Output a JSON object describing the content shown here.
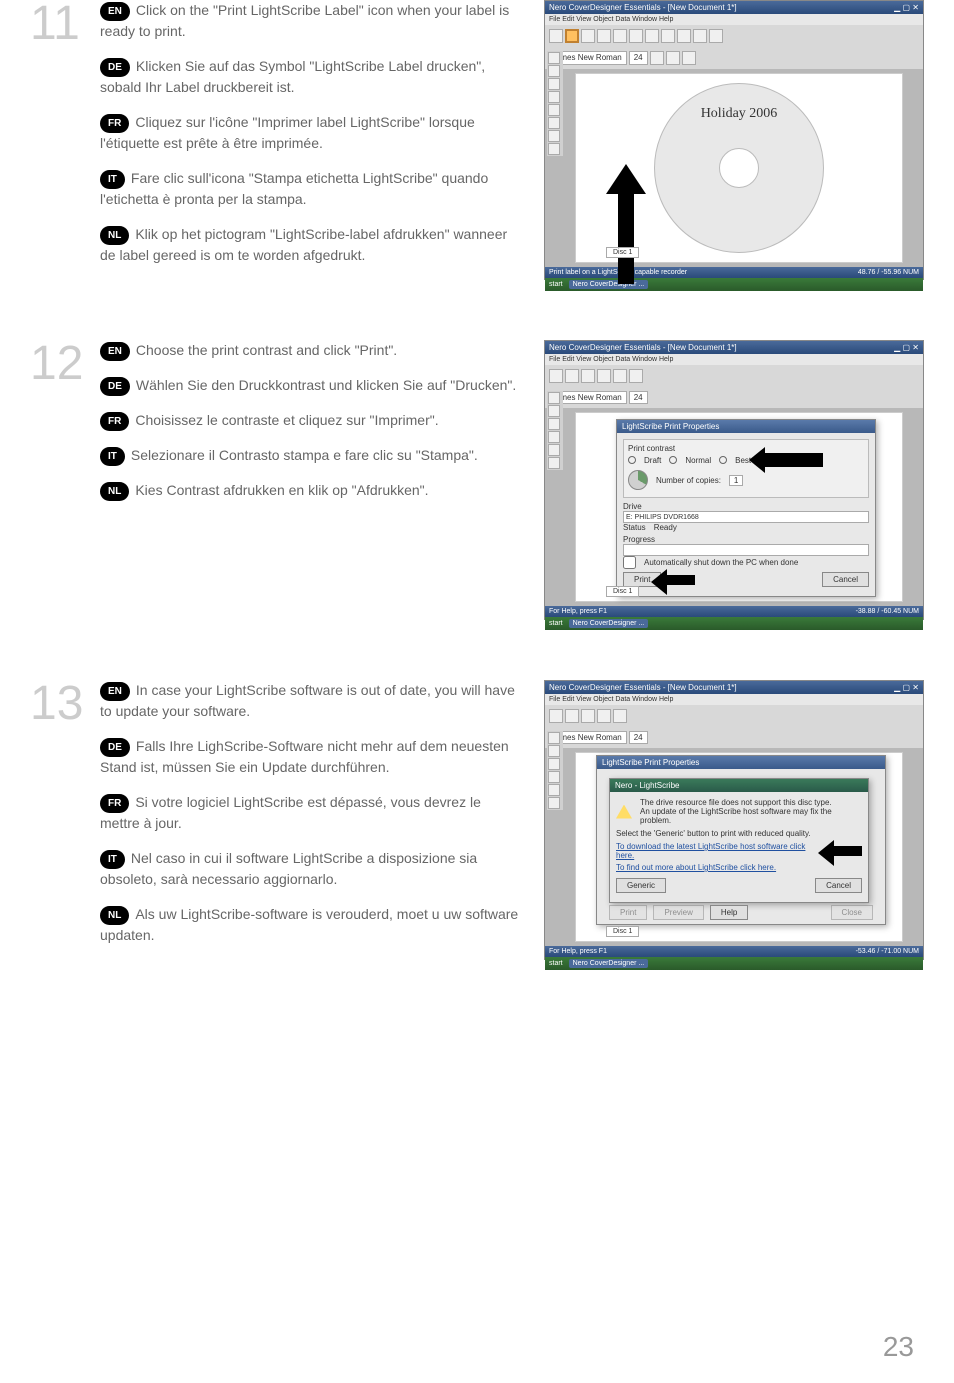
{
  "page_number": "23",
  "steps": [
    {
      "number": "11",
      "langs": {
        "en": "Click on the \"Print LightScribe Label\" icon when your label is ready to print.",
        "de": "Klicken Sie auf das Symbol \"LightScribe Label drucken\", sobald Ihr Label druckbereit ist.",
        "fr": "Cliquez sur l'icône \"Imprimer label LightScribe\" lorsque l'étiquette est prête à être imprimée.",
        "it": "Fare clic sull'icona \"Stampa etichetta LightScribe\" quando l'etichetta è pronta per la stampa.",
        "nl": "Klik op het pictogram \"LightScribe-label afdrukken\" wanneer de label gereed is om te worden afgedrukt."
      },
      "screenshot": {
        "title": "Nero CoverDesigner Essentials - [New Document 1*]",
        "menubar": "File  Edit  View  Object  Data  Window  Help",
        "font_name": "Times New Roman",
        "font_size": "24",
        "disc_text": "Holiday 2006",
        "disc_field": "Disc 1",
        "status": "Print label on a LightScribe capable recorder",
        "status_right": "48.76 / -55.96    NUM",
        "taskbar_start": "start",
        "taskbar_app": "Nero CoverDesigner ..."
      }
    },
    {
      "number": "12",
      "langs": {
        "en": "Choose the print contrast and click \"Print\".",
        "de": "Wählen Sie den Druckkontrast und klicken Sie auf \"Drucken\".",
        "fr": "Choisissez le contraste et cliquez sur \"Imprimer\".",
        "it": "Selezionare il Contrasto stampa e fare clic su \"Stampa\".",
        "nl": "Kies Contrast afdrukken en klik op \"Afdrukken\"."
      },
      "screenshot": {
        "title": "Nero CoverDesigner Essentials - [New Document 1*]",
        "menubar": "File  Edit  View  Object  Data  Window  Help",
        "font_name": "Times New Roman",
        "font_size": "24",
        "dialog_title": "LightScribe Print Properties",
        "contrast_label": "Print contrast",
        "opt_draft": "Draft",
        "opt_normal": "Normal",
        "opt_best": "Best",
        "copies_label": "Number of copies:",
        "copies_value": "1",
        "drive_label": "Drive",
        "drive_value": "E: PHILIPS  DVDR1668",
        "status_label": "Status",
        "status_value": "Ready",
        "progress_label": "Progress",
        "auto_close": "Automatically shut down the PC when done",
        "btn_print": "Print",
        "btn_cancel": "Cancel",
        "help_status": "For Help, press F1",
        "disc_field": "Disc 1",
        "status_right": "-38.88 / -60.45    NUM",
        "taskbar_start": "start",
        "taskbar_app": "Nero CoverDesigner ..."
      }
    },
    {
      "number": "13",
      "langs": {
        "en": "In case your LightScribe software is out of date, you will have to update your software.",
        "de": "Falls Ihre LighScribe-Software nicht mehr auf dem neuesten Stand ist, müssen Sie ein Update durchführen.",
        "fr": "Si votre logiciel LightScribe est dépassé, vous devrez le mettre à jour.",
        "it": "Nel caso in cui il software LightScribe a disposizione sia obsoleto, sarà necessario aggiornarlo.",
        "nl": "Als uw LightScribe-software is verouderd, moet u uw software updaten."
      },
      "screenshot": {
        "title": "Nero CoverDesigner Essentials - [New Document 1*]",
        "menubar": "File  Edit  View  Object  Data  Window  Help",
        "font_name": "Times New Roman",
        "font_size": "24",
        "dialog_outer_title": "LightScribe Print Properties",
        "dialog_title": "Nero - LightScribe",
        "warn_line1": "The drive resource file does not support this disc type.",
        "warn_line2": "An update of the LightScribe host software may fix the problem.",
        "instr_generic": "Select the 'Generic' button to print with reduced quality.",
        "link_download": "To download the latest LightScribe host software click here.",
        "link_find": "To find out more about LightScribe click here.",
        "btn_generic": "Generic",
        "btn_cancel": "Cancel",
        "btn_print": "Print",
        "btn_preview": "Preview",
        "btn_help": "Help",
        "btn_close": "Close",
        "help_status": "For Help, press F1",
        "disc_field": "Disc 1",
        "status_right": "-53.46 / -71.00    NUM",
        "taskbar_start": "start",
        "taskbar_app": "Nero CoverDesigner ..."
      }
    }
  ],
  "badges": {
    "en": "EN",
    "de": "DE",
    "fr": "FR",
    "it": "IT",
    "nl": "NL"
  }
}
